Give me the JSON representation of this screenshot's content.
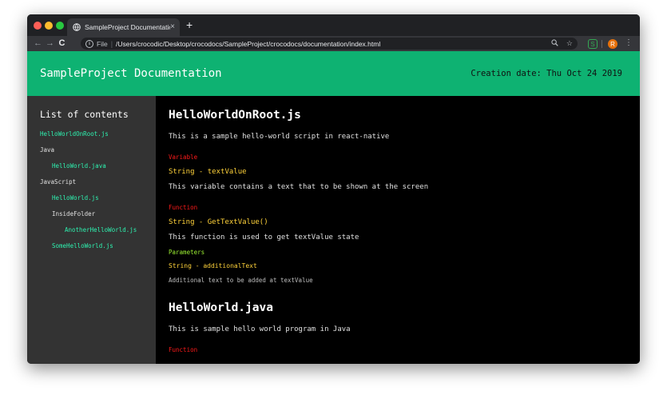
{
  "browser": {
    "tab_title": "SampleProject Documentation",
    "tab_close": "×",
    "new_tab": "+",
    "nav": {
      "back": "←",
      "forward": "→",
      "reload": "C"
    },
    "scheme": "File",
    "url": "/Users/crocodic/Desktop/crocodocs/SampleProject/crocodocs/documentation/index.html",
    "extensions": {
      "s": "S",
      "r": "R"
    }
  },
  "header": {
    "title": "SampleProject Documentation",
    "creation_date": "Creation date: Thu Oct 24 2019"
  },
  "sidebar": {
    "heading": "List of contents",
    "items": [
      {
        "label": "HelloWorldOnRoot.js",
        "type": "file",
        "level": 0
      },
      {
        "label": "Java",
        "type": "folder",
        "level": 0
      },
      {
        "label": "HelloWorld.java",
        "type": "file",
        "level": 1
      },
      {
        "label": "JavaScript",
        "type": "folder",
        "level": 0
      },
      {
        "label": "HelloWorld.js",
        "type": "file",
        "level": 1
      },
      {
        "label": "InsideFolder",
        "type": "folder",
        "level": 1
      },
      {
        "label": "AnotherHelloWorld.js",
        "type": "file",
        "level": 2
      },
      {
        "label": "SomeHelloWorld.js",
        "type": "file",
        "level": 1
      }
    ]
  },
  "main": {
    "file1": {
      "title": "HelloWorldOnRoot.js",
      "description": "This is a sample hello-world script in react-native",
      "variable": {
        "kind": "Variable",
        "signature": "String - textValue",
        "description": "This variable contains a text that to be shown at the screen"
      },
      "function": {
        "kind": "Function",
        "signature": "String - GetTextValue()",
        "description": "This function is used to get textValue state",
        "params_label": "Parameters",
        "param_signature": "String - additionalText",
        "param_description": "Additional text to be added at textValue"
      }
    },
    "file2": {
      "title": "HelloWorld.java",
      "description": "This is sample hello world program in Java",
      "kind": "Function"
    }
  },
  "colors": {
    "header_bg": "#0eb272",
    "sidebar_bg": "#333333",
    "sidebar_file": "#2ef2b0",
    "kind_red": "#ff1a1a",
    "signature_yellow": "#ffd23a",
    "params_green": "#9df233"
  }
}
